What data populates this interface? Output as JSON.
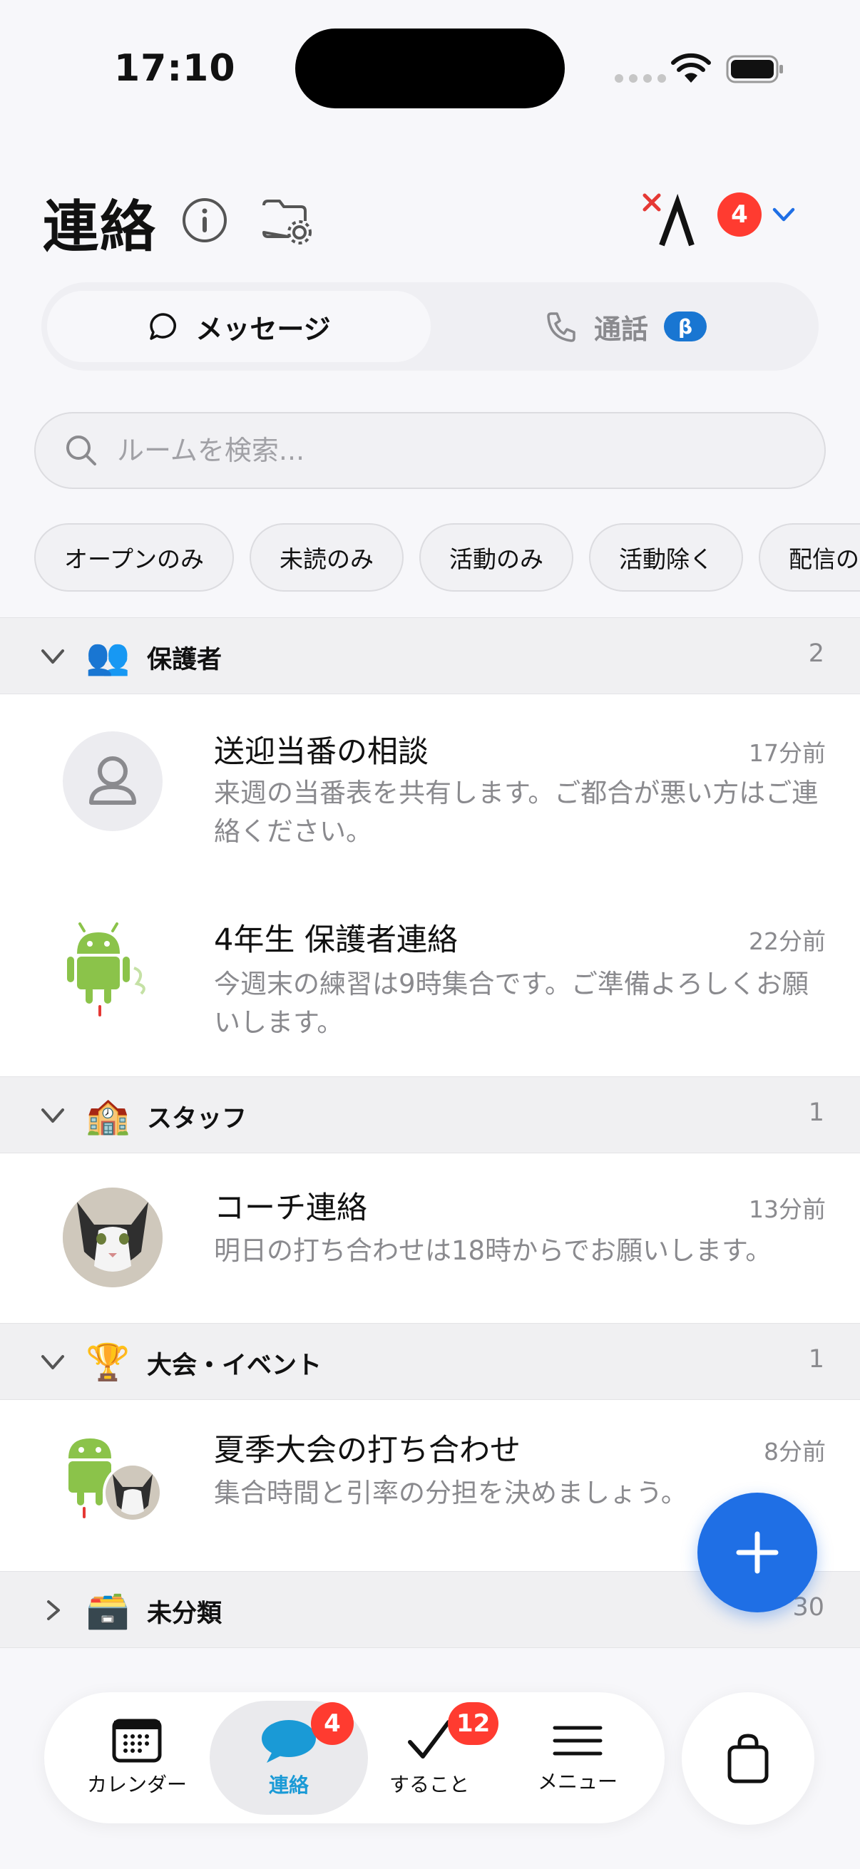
{
  "status_bar": {
    "time": "17:10"
  },
  "header": {
    "title": "連絡",
    "badge_count": "4"
  },
  "segment": {
    "messages_label": "メッセージ",
    "calls_label": "通話",
    "beta_label": "β"
  },
  "search": {
    "placeholder": "ルームを検索..."
  },
  "filters": [
    "オープンのみ",
    "未読のみ",
    "活動のみ",
    "活動除く",
    "配信のみ"
  ],
  "sections": [
    {
      "title": "保護者",
      "count": "2",
      "emoji": "👥",
      "rooms": [
        {
          "title": "送迎当番の相談",
          "time": "17分前",
          "preview": "来週の当番表を共有します。ご都合が悪い方はご連絡ください。"
        },
        {
          "title": "4年生 保護者連絡",
          "time": "22分前",
          "preview": "今週末の練習は9時集合です。ご準備よろしくお願いします。"
        }
      ]
    },
    {
      "title": "スタッフ",
      "count": "1",
      "emoji": "🏫",
      "rooms": [
        {
          "title": "コーチ連絡",
          "time": "13分前",
          "preview": "明日の打ち合わせは18時からでお願いします。"
        }
      ]
    },
    {
      "title": "大会・イベント",
      "count": "1",
      "emoji": "🏆",
      "rooms": [
        {
          "title": "夏季大会の打ち合わせ",
          "time": "8分前",
          "preview": "集合時間と引率の分担を決めましょう。"
        }
      ]
    },
    {
      "title": "未分類",
      "count": "30",
      "emoji": "🗃️"
    }
  ],
  "tabbar": {
    "calendar_label": "カレンダー",
    "contact_label": "連絡",
    "contact_badge": "4",
    "todo_label": "すること",
    "todo_badge": "12",
    "menu_label": "メニュー"
  },
  "colors": {
    "accent": "#1f6fe5",
    "badge": "#ff3b30",
    "active_tab": "#1a9ad6"
  }
}
